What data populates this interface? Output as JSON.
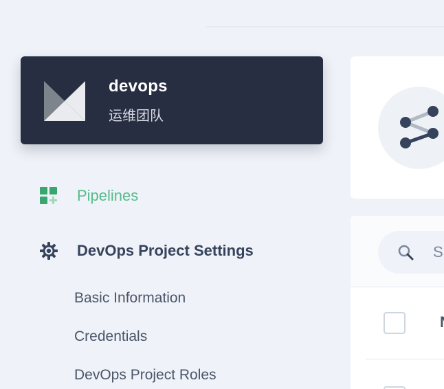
{
  "project": {
    "name": "devops",
    "description": "运维团队"
  },
  "nav": {
    "pipelines": {
      "label": "Pipelines",
      "icon": "pipeline-grid-icon",
      "color": "#55bc8a"
    },
    "settings": {
      "label": "DevOps Project Settings",
      "icon": "gear-icon",
      "items": [
        {
          "label": "Basic Information"
        },
        {
          "label": "Credentials"
        },
        {
          "label": "DevOps Project Roles"
        }
      ]
    }
  },
  "main": {
    "summary_icon": "pipeline-share-icon",
    "search": {
      "placeholder": "S"
    },
    "table": {
      "header_first_col": "N"
    }
  },
  "colors": {
    "sidebar_card": "#282e41",
    "accent": "#55bc8a",
    "background": "#eff2f8"
  }
}
